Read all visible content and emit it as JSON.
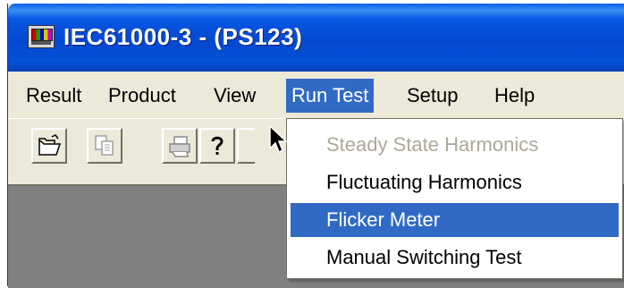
{
  "window": {
    "title": "IEC61000-3 - (PS123)"
  },
  "menubar": {
    "items": [
      {
        "label": "Result"
      },
      {
        "label": "Product"
      },
      {
        "label": "View"
      },
      {
        "label": "Run Test"
      },
      {
        "label": "Setup"
      },
      {
        "label": "Help"
      }
    ],
    "active": "Run Test"
  },
  "toolbar": {
    "buttons": [
      {
        "icon": "open-folder-icon"
      },
      {
        "icon": "copy-icon"
      },
      {
        "icon": "print-icon"
      },
      {
        "icon": "help-icon"
      }
    ]
  },
  "run_test_menu": {
    "items": [
      {
        "label": "Steady State Harmonics",
        "state": "disabled"
      },
      {
        "label": "Fluctuating Harmonics",
        "state": "normal"
      },
      {
        "label": "Flicker Meter",
        "state": "highlighted"
      },
      {
        "label": "Manual Switching Test",
        "state": "normal"
      }
    ]
  },
  "colors": {
    "title_bar": "#0548d0",
    "menu_highlight": "#316ac5",
    "disabled_text": "#aca899",
    "face": "#ece9d8",
    "client_area": "#808080"
  }
}
